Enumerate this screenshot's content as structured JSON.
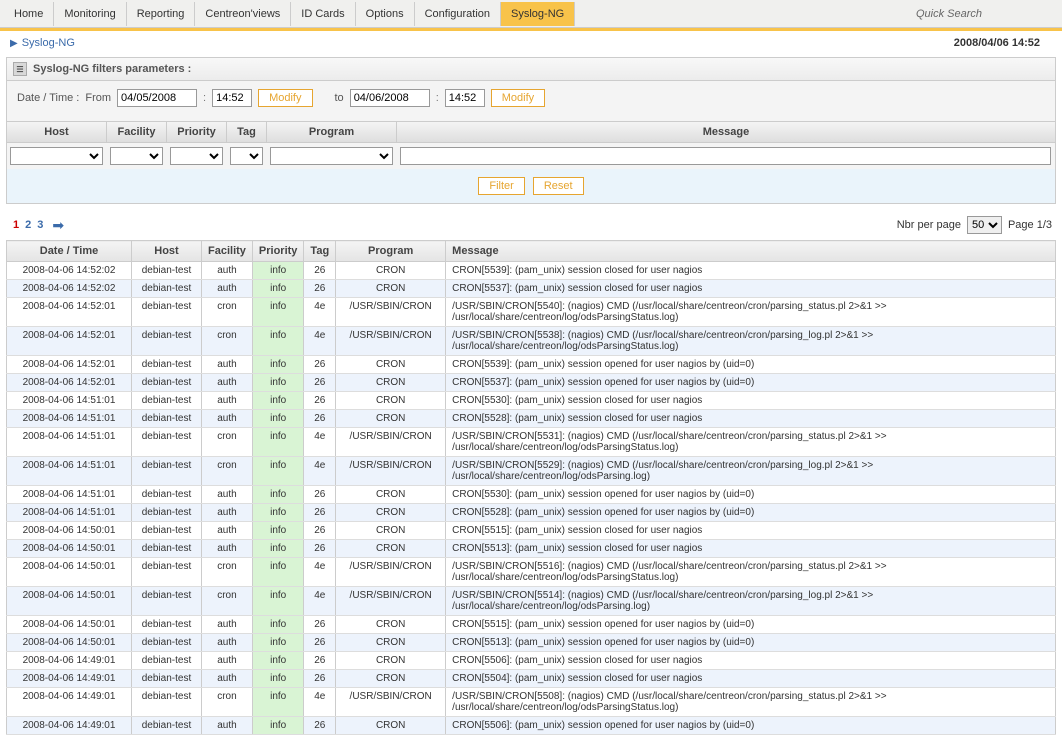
{
  "tabs": [
    "Home",
    "Monitoring",
    "Reporting",
    "Centreon'views",
    "ID Cards",
    "Options",
    "Configuration",
    "Syslog-NG"
  ],
  "active_tab": 7,
  "quick_search": "Quick Search",
  "breadcrumb": "Syslog-NG",
  "top_datetime": "2008/04/06 14:52",
  "panel_title": "Syslog-NG filters parameters :",
  "form": {
    "datetime_label": "Date / Time :",
    "from_label": "From",
    "from_date": "04/05/2008",
    "from_time": "14:52",
    "modify_label": "Modify",
    "to_label": "to",
    "to_date": "04/06/2008",
    "to_time": "14:52"
  },
  "filter_headers": {
    "host": "Host",
    "facility": "Facility",
    "priority": "Priority",
    "tag": "Tag",
    "program": "Program",
    "message": "Message"
  },
  "buttons": {
    "filter": "Filter",
    "reset": "Reset"
  },
  "pagination": {
    "pages": [
      "1",
      "2",
      "3"
    ],
    "current": 0,
    "nbr_label": "Nbr per page",
    "nbr_value": "50",
    "page_label": "Page 1/3"
  },
  "columns": [
    "Date / Time",
    "Host",
    "Facility",
    "Priority",
    "Tag",
    "Program",
    "Message"
  ],
  "rows": [
    {
      "dt": "2008-04-06 14:52:02",
      "host": "debian-test",
      "fac": "auth",
      "pri": "info",
      "tag": "26",
      "prog": "CRON",
      "msg": "CRON[5539]: (pam_unix) session closed for user nagios"
    },
    {
      "dt": "2008-04-06 14:52:02",
      "host": "debian-test",
      "fac": "auth",
      "pri": "info",
      "tag": "26",
      "prog": "CRON",
      "msg": "CRON[5537]: (pam_unix) session closed for user nagios"
    },
    {
      "dt": "2008-04-06 14:52:01",
      "host": "debian-test",
      "fac": "cron",
      "pri": "info",
      "tag": "4e",
      "prog": "/USR/SBIN/CRON",
      "msg": "/USR/SBIN/CRON[5540]: (nagios) CMD (/usr/local/share/centreon/cron/parsing_status.pl 2>&1 >> /usr/local/share/centreon/log/odsParsingStatus.log)"
    },
    {
      "dt": "2008-04-06 14:52:01",
      "host": "debian-test",
      "fac": "cron",
      "pri": "info",
      "tag": "4e",
      "prog": "/USR/SBIN/CRON",
      "msg": "/USR/SBIN/CRON[5538]: (nagios) CMD (/usr/local/share/centreon/cron/parsing_log.pl 2>&1 >> /usr/local/share/centreon/log/odsParsingStatus.log)"
    },
    {
      "dt": "2008-04-06 14:52:01",
      "host": "debian-test",
      "fac": "auth",
      "pri": "info",
      "tag": "26",
      "prog": "CRON",
      "msg": "CRON[5539]: (pam_unix) session opened for user nagios by (uid=0)"
    },
    {
      "dt": "2008-04-06 14:52:01",
      "host": "debian-test",
      "fac": "auth",
      "pri": "info",
      "tag": "26",
      "prog": "CRON",
      "msg": "CRON[5537]: (pam_unix) session opened for user nagios by (uid=0)"
    },
    {
      "dt": "2008-04-06 14:51:01",
      "host": "debian-test",
      "fac": "auth",
      "pri": "info",
      "tag": "26",
      "prog": "CRON",
      "msg": "CRON[5530]: (pam_unix) session closed for user nagios"
    },
    {
      "dt": "2008-04-06 14:51:01",
      "host": "debian-test",
      "fac": "auth",
      "pri": "info",
      "tag": "26",
      "prog": "CRON",
      "msg": "CRON[5528]: (pam_unix) session closed for user nagios"
    },
    {
      "dt": "2008-04-06 14:51:01",
      "host": "debian-test",
      "fac": "cron",
      "pri": "info",
      "tag": "4e",
      "prog": "/USR/SBIN/CRON",
      "msg": "/USR/SBIN/CRON[5531]: (nagios) CMD (/usr/local/share/centreon/cron/parsing_status.pl 2>&1 >> /usr/local/share/centreon/log/odsParsingStatus.log)"
    },
    {
      "dt": "2008-04-06 14:51:01",
      "host": "debian-test",
      "fac": "cron",
      "pri": "info",
      "tag": "4e",
      "prog": "/USR/SBIN/CRON",
      "msg": "/USR/SBIN/CRON[5529]: (nagios) CMD (/usr/local/share/centreon/cron/parsing_log.pl 2>&1 >> /usr/local/share/centreon/log/odsParsing.log)"
    },
    {
      "dt": "2008-04-06 14:51:01",
      "host": "debian-test",
      "fac": "auth",
      "pri": "info",
      "tag": "26",
      "prog": "CRON",
      "msg": "CRON[5530]: (pam_unix) session opened for user nagios by (uid=0)"
    },
    {
      "dt": "2008-04-06 14:51:01",
      "host": "debian-test",
      "fac": "auth",
      "pri": "info",
      "tag": "26",
      "prog": "CRON",
      "msg": "CRON[5528]: (pam_unix) session opened for user nagios by (uid=0)"
    },
    {
      "dt": "2008-04-06 14:50:01",
      "host": "debian-test",
      "fac": "auth",
      "pri": "info",
      "tag": "26",
      "prog": "CRON",
      "msg": "CRON[5515]: (pam_unix) session closed for user nagios"
    },
    {
      "dt": "2008-04-06 14:50:01",
      "host": "debian-test",
      "fac": "auth",
      "pri": "info",
      "tag": "26",
      "prog": "CRON",
      "msg": "CRON[5513]: (pam_unix) session closed for user nagios"
    },
    {
      "dt": "2008-04-06 14:50:01",
      "host": "debian-test",
      "fac": "cron",
      "pri": "info",
      "tag": "4e",
      "prog": "/USR/SBIN/CRON",
      "msg": "/USR/SBIN/CRON[5516]: (nagios) CMD (/usr/local/share/centreon/cron/parsing_status.pl 2>&1 >> /usr/local/share/centreon/log/odsParsingStatus.log)"
    },
    {
      "dt": "2008-04-06 14:50:01",
      "host": "debian-test",
      "fac": "cron",
      "pri": "info",
      "tag": "4e",
      "prog": "/USR/SBIN/CRON",
      "msg": "/USR/SBIN/CRON[5514]: (nagios) CMD (/usr/local/share/centreon/cron/parsing_log.pl 2>&1 >> /usr/local/share/centreon/log/odsParsing.log)"
    },
    {
      "dt": "2008-04-06 14:50:01",
      "host": "debian-test",
      "fac": "auth",
      "pri": "info",
      "tag": "26",
      "prog": "CRON",
      "msg": "CRON[5515]: (pam_unix) session opened for user nagios by (uid=0)"
    },
    {
      "dt": "2008-04-06 14:50:01",
      "host": "debian-test",
      "fac": "auth",
      "pri": "info",
      "tag": "26",
      "prog": "CRON",
      "msg": "CRON[5513]: (pam_unix) session opened for user nagios by (uid=0)"
    },
    {
      "dt": "2008-04-06 14:49:01",
      "host": "debian-test",
      "fac": "auth",
      "pri": "info",
      "tag": "26",
      "prog": "CRON",
      "msg": "CRON[5506]: (pam_unix) session closed for user nagios"
    },
    {
      "dt": "2008-04-06 14:49:01",
      "host": "debian-test",
      "fac": "auth",
      "pri": "info",
      "tag": "26",
      "prog": "CRON",
      "msg": "CRON[5504]: (pam_unix) session closed for user nagios"
    },
    {
      "dt": "2008-04-06 14:49:01",
      "host": "debian-test",
      "fac": "cron",
      "pri": "info",
      "tag": "4e",
      "prog": "/USR/SBIN/CRON",
      "msg": "/USR/SBIN/CRON[5508]: (nagios) CMD (/usr/local/share/centreon/cron/parsing_status.pl 2>&1 >> /usr/local/share/centreon/log/odsParsingStatus.log)"
    },
    {
      "dt": "2008-04-06 14:49:01",
      "host": "debian-test",
      "fac": "auth",
      "pri": "info",
      "tag": "26",
      "prog": "CRON",
      "msg": "CRON[5506]: (pam_unix) session opened for user nagios by (uid=0)"
    }
  ]
}
